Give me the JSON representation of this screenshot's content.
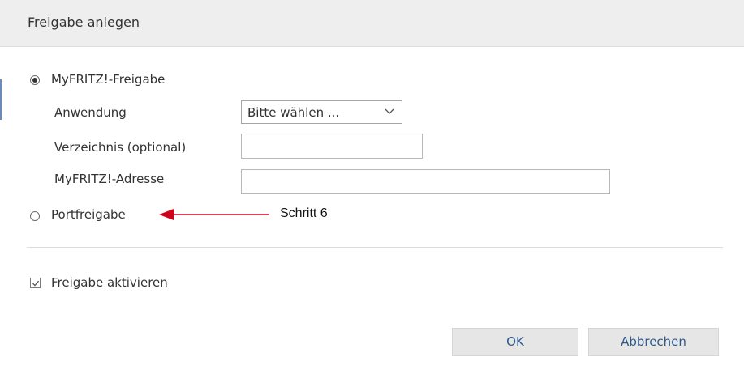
{
  "dialog": {
    "title": "Freigabe anlegen"
  },
  "share_type": {
    "myfritz_label": "MyFRITZ!-Freigabe",
    "myfritz_selected": true,
    "port_label": "Portfreigabe",
    "port_selected": false
  },
  "fields": {
    "application_label": "Anwendung",
    "application_value": "Bitte wählen ...",
    "directory_label": "Verzeichnis (optional)",
    "directory_value": "",
    "address_label": "MyFRITZ!-Adresse",
    "address_value": ""
  },
  "annotation": {
    "text": "Schritt 6",
    "color": "#d0021b"
  },
  "activate": {
    "label": "Freigabe aktivieren",
    "checked": true
  },
  "buttons": {
    "ok": "OK",
    "cancel": "Abbrechen"
  },
  "icons": {
    "select": "chevron-down-icon",
    "checkbox": "check-icon",
    "annotation": "arrow-left-icon"
  }
}
